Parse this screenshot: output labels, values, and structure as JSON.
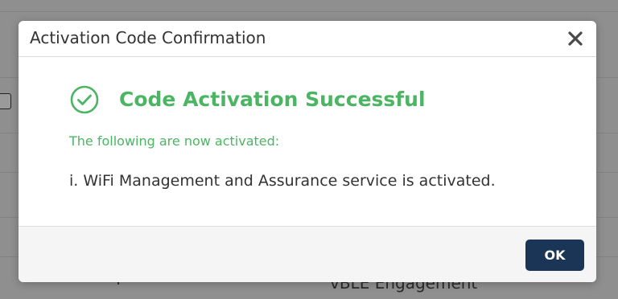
{
  "colors": {
    "success_green": "#4cb563",
    "primary_button": "#1b3556",
    "title_text": "#333333"
  },
  "background": {
    "partial_text": "vBLE Engagement"
  },
  "dialog": {
    "title": "Activation Code Confirmation",
    "close_icon": "close-icon",
    "status_icon": "check-circle-icon",
    "heading": "Code Activation Successful",
    "subheading": "The following are now activated:",
    "items": [
      "i. WiFi Management and Assurance service is activated."
    ],
    "ok_label": "OK"
  }
}
